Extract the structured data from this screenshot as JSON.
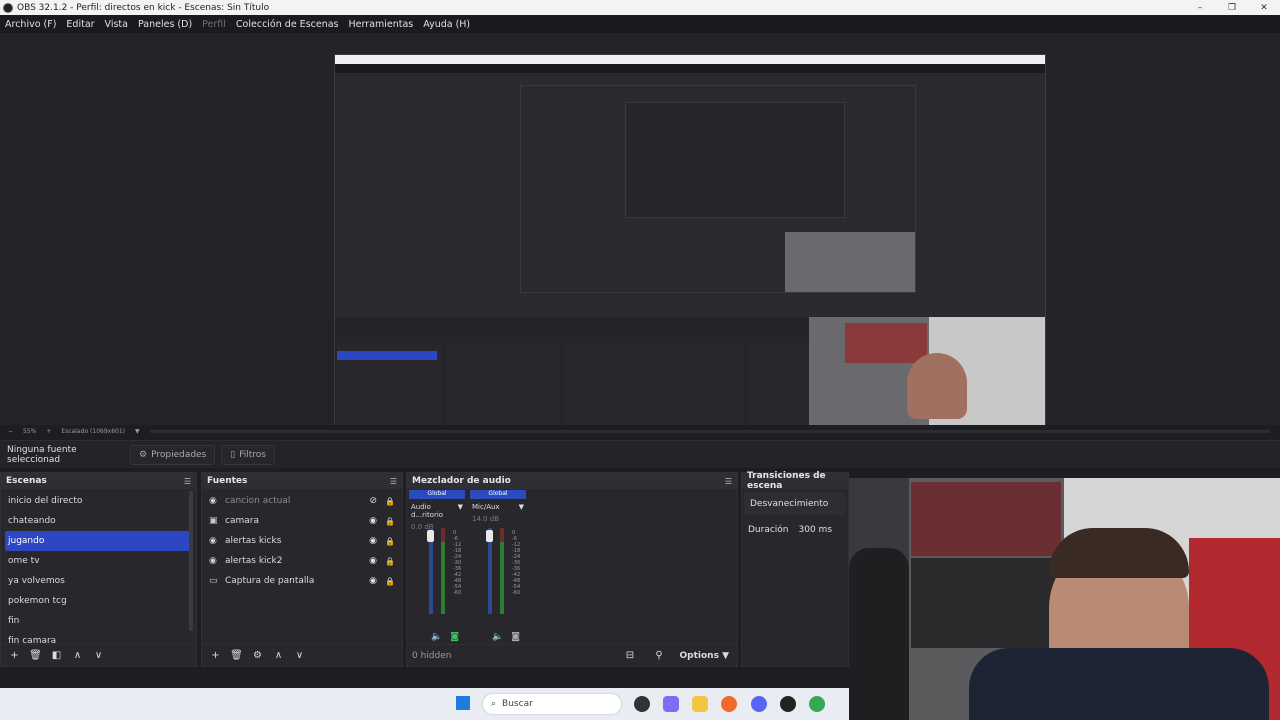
{
  "window": {
    "title": "OBS 32.1.2 - Perfil: directos en kick - Escenas: Sin Título",
    "controls": [
      "–",
      "❐",
      "✕"
    ]
  },
  "menu": {
    "items": [
      "Archivo (F)",
      "Editar",
      "Vista",
      "Paneles (D)",
      "Perfil",
      "Colección de Escenas",
      "Herramientas",
      "Ayuda (H)"
    ]
  },
  "preview_footer": {
    "zoom": "55%",
    "scale": "Escalado (1069x601)"
  },
  "context_bar": {
    "selection": "Ninguna fuente seleccionad",
    "properties": "Propiedades",
    "filters": "Filtros"
  },
  "scenes": {
    "title": "Escenas",
    "items": [
      "inicio del directo",
      "chateando",
      "jugando",
      "ome tv",
      "ya volvemos",
      "pokemon tcg",
      "fin",
      "fin camara"
    ],
    "selected_index": 2
  },
  "sources": {
    "title": "Fuentes",
    "items": [
      {
        "name": "cancion actual",
        "icon": "globe-icon"
      },
      {
        "name": "camara",
        "icon": "camera-icon"
      },
      {
        "name": "alertas kicks",
        "icon": "globe-icon"
      },
      {
        "name": "alertas kick2",
        "icon": "globe-icon"
      },
      {
        "name": "Captura de pantalla",
        "icon": "monitor-icon"
      }
    ]
  },
  "mixer": {
    "title": "Mezclador de audio",
    "channels": [
      {
        "tag": "Global",
        "name": "Audio d...ritorio",
        "db": "0.0 dB"
      },
      {
        "tag": "Global",
        "name": "Mic/Aux",
        "db": "14.0 dB"
      }
    ],
    "scale": [
      "0",
      "-6",
      "-12",
      "-18",
      "-24",
      "-30",
      "-36",
      "-42",
      "-48",
      "-54",
      "-60"
    ],
    "hidden": "0 hidden",
    "options": "Options"
  },
  "transitions": {
    "title": "Transiciones de escena",
    "type": "Desvanecimiento",
    "duration_label": "Duración",
    "duration_value": "300 ms"
  },
  "taskbar": {
    "search_placeholder": "Buscar"
  },
  "colors": {
    "accent": "#2c46c4",
    "panel": "#27272c",
    "background": "#1e1e22"
  }
}
